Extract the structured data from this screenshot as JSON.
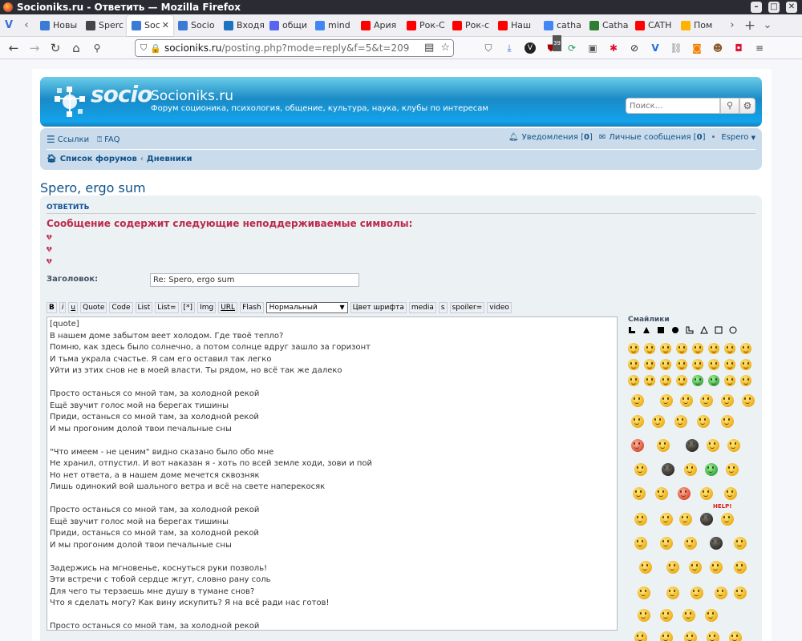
{
  "browser": {
    "window_title": "Socioniks.ru - Ответить — Mozilla Firefox",
    "tabs": [
      {
        "label": "Новы",
        "fav": "#3a7bd5"
      },
      {
        "label": "Sperc",
        "fav": "#444"
      },
      {
        "label": "Soc",
        "fav": "#3a7bd5"
      },
      {
        "label": "Socio",
        "fav": "#3a7bd5"
      },
      {
        "label": "Входя",
        "fav": "#1e73be"
      },
      {
        "label": "общи",
        "fav": "#5865f2"
      },
      {
        "label": "mind",
        "fav": "#4285f4"
      },
      {
        "label": "Ария",
        "fav": "#ff0000"
      },
      {
        "label": "Рок-С",
        "fav": "#ff0000"
      },
      {
        "label": "Рок-с",
        "fav": "#ff0000"
      },
      {
        "label": "Наш",
        "fav": "#ff0000"
      },
      {
        "label": "catha",
        "fav": "#4285f4"
      },
      {
        "label": "Catha",
        "fav": "#2e7d32"
      },
      {
        "label": "CATH",
        "fav": "#ff0000"
      },
      {
        "label": "Пом",
        "fav": "#ffb300"
      }
    ],
    "active_tab_index": 2,
    "url_host": "socioniks.ru",
    "url_path": "/posting.php?mode=reply&f=5&t=209",
    "ext_badge": "39"
  },
  "site": {
    "logo_text": "socio",
    "title": "Socioniks.ru",
    "description": "Форум соционика, психология, общение, культура, наука, клубы по интересам",
    "search_placeholder": "Поиск…"
  },
  "nav": {
    "links": "Ссылки",
    "faq": "FAQ",
    "notifications_label": "Уведомления",
    "notifications_count": "0",
    "messages_label": "Личные сообщения",
    "messages_count": "0",
    "username": "Espero",
    "breadcrumb": [
      "Список форумов",
      "Дневники"
    ]
  },
  "topic": {
    "title": "Spero, ergo sum",
    "panel_heading": "Ответить",
    "warning": "Сообщение содержит следующие неподдерживаемые символы:",
    "subject_label": "Заголовок:",
    "subject_value": "Re: Spero, ergo sum"
  },
  "toolbar": {
    "buttons": [
      "B",
      "i",
      "u",
      "Quote",
      "Code",
      "List",
      "List=",
      "[*]",
      "Img",
      "URL",
      "Flash"
    ],
    "font_size": "Нормальный",
    "buttons2": [
      "Цвет шрифта",
      "media",
      "s",
      "spoiler=",
      "video"
    ]
  },
  "message": "[quote]\nВ нашем доме забытом веет холодом. Где твоё тепло?\nПомню, как здесь было солнечно, а потом солнце вдруг зашло за горизонт\nИ тьма украла счастье. Я сам его оставил так легко\nУйти из этих снов не в моей власти. Ты рядом, но всё так же далеко\n\nПросто останься со мной там, за холодной рекой\nЕщё звучит голос мой на берегах тишины\nПриди, останься со мной там, за холодной рекой\nИ мы прогоним долой твои печальные сны\n\n\"Что имеем - не ценим\" видно сказано было обо мне\nНе хранил, отпустил. И вот наказан я - хоть по всей земле ходи, зови и пой\nНо нет ответа, а в нашем доме мечется сквозняк\nЛишь одинокий вой шального ветра и всё на свете наперекосяк\n\nПросто останься со мной там, за холодной рекой\nЕщё звучит голос мой на берегах тишины\nПриди, останься со мной там, за холодной рекой\nИ мы прогоним долой твои печальные сны\n\nЗадержись на мгновенье, коснуться руки позволь!\nЭти встречи с тобой сердце жгут, словно рану соль\nДля чего ты терзаешь мне душу в тумане снов?\nЧто я сделать могу? Как вину искупить? Я на всё ради нас готов!\n\nПросто останься со мной там, за холодной рекой",
  "smilies": {
    "heading": "Смайлики",
    "help_text": "HELP!"
  },
  "colors": {
    "link": "#105289",
    "warning": "#bc2a4d",
    "header_blue": "#12A3EB"
  }
}
